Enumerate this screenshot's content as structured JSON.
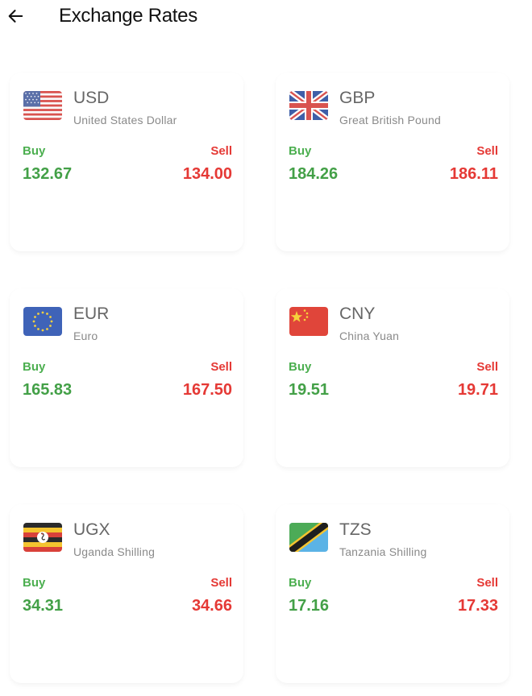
{
  "header": {
    "title": "Exchange Rates",
    "back_icon": "arrow-left-icon"
  },
  "colors": {
    "buy": "#4caf50",
    "sell": "#e53935"
  },
  "labels": {
    "buy": "Buy",
    "sell": "Sell"
  },
  "currencies": [
    {
      "code": "USD",
      "name": "United States Dollar",
      "buy": "132.67",
      "sell": "134.00",
      "flag_icon": "us-flag-icon"
    },
    {
      "code": "GBP",
      "name": "Great British Pound",
      "buy": "184.26",
      "sell": "186.11",
      "flag_icon": "uk-flag-icon"
    },
    {
      "code": "EUR",
      "name": "Euro",
      "buy": "165.83",
      "sell": "167.50",
      "flag_icon": "eu-flag-icon"
    },
    {
      "code": "CNY",
      "name": "China Yuan",
      "buy": "19.51",
      "sell": "19.71",
      "flag_icon": "china-flag-icon"
    },
    {
      "code": "UGX",
      "name": "Uganda Shilling",
      "buy": "34.31",
      "sell": "34.66",
      "flag_icon": "uganda-flag-icon"
    },
    {
      "code": "TZS",
      "name": "Tanzania Shilling",
      "buy": "17.16",
      "sell": "17.33",
      "flag_icon": "tanzania-flag-icon"
    }
  ]
}
